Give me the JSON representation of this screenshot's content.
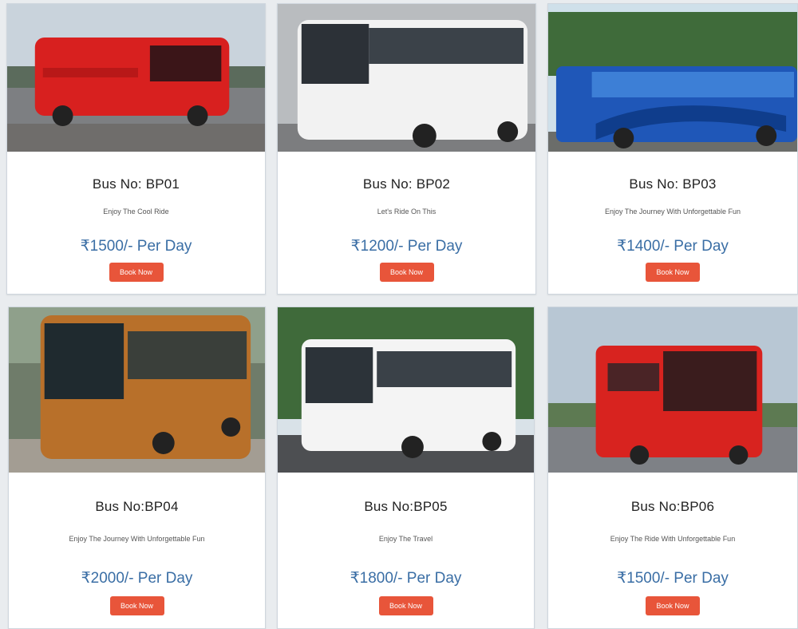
{
  "cards": [
    {
      "title": "Bus No: BP01",
      "subtitle": "Enjoy The Cool Ride",
      "price": "₹1500/- Per Day",
      "button": "Book Now",
      "image": "red-sleeper-bus-photo"
    },
    {
      "title": "Bus No: BP02",
      "subtitle": "Let's Ride On This",
      "price": "₹1200/- Per Day",
      "button": "Book Now",
      "image": "white-volvo-bus-photo"
    },
    {
      "title": "Bus No: BP03",
      "subtitle": "Enjoy The Journey With Unforgettable Fun",
      "price": "₹1400/- Per Day",
      "button": "Book Now",
      "image": "blue-coach-bus-photo"
    },
    {
      "title": "Bus No:BP04",
      "subtitle": "Enjoy The Journey With Unforgettable Fun",
      "price": "₹2000/- Per Day",
      "button": "Book Now",
      "image": "orange-coach-bus-photo"
    },
    {
      "title": "Bus No:BP05",
      "subtitle": "Enjoy The Travel",
      "price": "₹1800/- Per Day",
      "button": "Book Now",
      "image": "white-coach-bus-photo"
    },
    {
      "title": "Bus No:BP06",
      "subtitle": "Enjoy The Ride With Unforgettable Fun",
      "price": "₹1500/- Per Day",
      "button": "Book Now",
      "image": "red-city-bus-photo"
    }
  ],
  "colors": {
    "button": "#e8553a",
    "price": "#3a6ea5",
    "title": "#222222"
  }
}
